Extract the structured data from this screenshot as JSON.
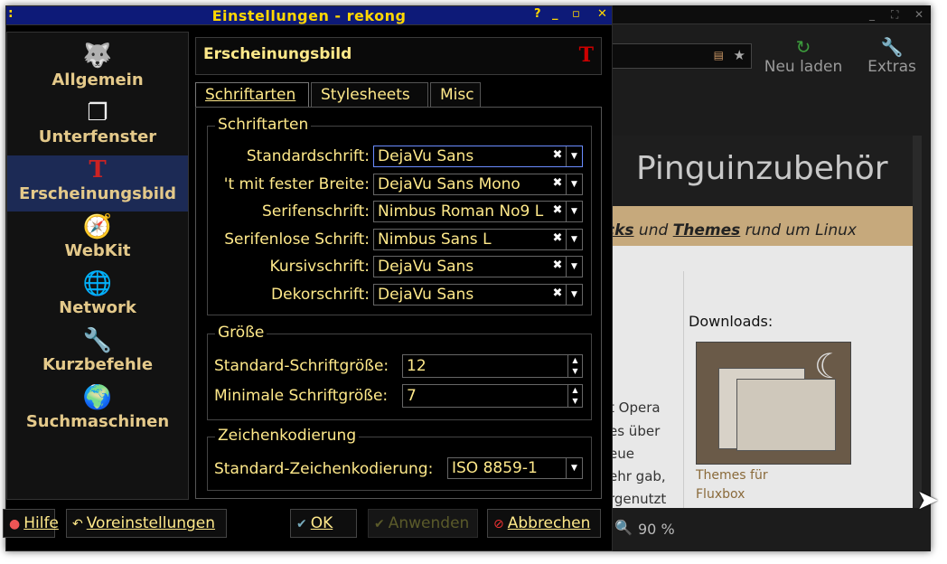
{
  "dialog": {
    "title": "Einstellungen - rekong",
    "left_marker": ":",
    "controls": [
      "?",
      "_",
      "▫",
      "✕"
    ]
  },
  "sidebar": {
    "items": [
      {
        "label": "Allgemein",
        "icon": "wolf-icon"
      },
      {
        "label": "Unterfenster",
        "icon": "windows-icon"
      },
      {
        "label": "Erscheinungsbild",
        "icon": "appearance-icon",
        "active": true
      },
      {
        "label": "WebKit",
        "icon": "compass-icon"
      },
      {
        "label": "Network",
        "icon": "network-globe-icon"
      },
      {
        "label": "Kurzbefehle",
        "icon": "wrench-icon"
      },
      {
        "label": "Suchmaschinen",
        "icon": "search-globe-icon"
      }
    ]
  },
  "page": {
    "title": "Erscheinungsbild",
    "tabs": [
      {
        "label": "Schriftarten",
        "active": true
      },
      {
        "label": "Stylesheets"
      },
      {
        "label": "Misc"
      }
    ]
  },
  "fonts_group": {
    "title": "Schriftarten",
    "rows": [
      {
        "label": "Standardschrift:",
        "value": "DejaVu Sans"
      },
      {
        "label": "'t mit fester Breite:",
        "value": "DejaVu Sans Mono"
      },
      {
        "label": "Serifenschrift:",
        "value": "Nimbus Roman No9 L"
      },
      {
        "label": "Serifenlose Schrift:",
        "value": "Nimbus Sans L"
      },
      {
        "label": "Kursivschrift:",
        "value": "DejaVu Sans"
      },
      {
        "label": "Dekorschrift:",
        "value": "DejaVu Sans"
      }
    ]
  },
  "size_group": {
    "title": "Größe",
    "rows": [
      {
        "label": "Standard-Schriftgröße:",
        "value": "12"
      },
      {
        "label": "Minimale Schriftgröße:",
        "value": "7"
      }
    ]
  },
  "encoding_group": {
    "title": "Zeichenkodierung",
    "label": "Standard-Zeichenkodierung:",
    "value": "ISO 8859-1"
  },
  "buttons": {
    "help": "Hilfe",
    "defaults": "Voreinstellungen",
    "ok": "OK",
    "apply": "Anwenden",
    "cancel": "Abbrechen"
  },
  "browser": {
    "reload": "Neu laden",
    "extras": "Extras",
    "page_title": "Pinguinzubehör",
    "tagline_a": "cks",
    "tagline_b": " und ",
    "tagline_c": "Themes",
    "tagline_d": " rund um Linux",
    "downloads": "Downloads:",
    "caption_1": "Themes für",
    "caption_2": "Fluxbox",
    "text_lines": [
      "t Opera",
      "es über",
      "eue",
      "ehr gab,",
      "rgenutzt"
    ],
    "zoom": "90 %"
  },
  "colors": {
    "titlebar": "#0d1a78",
    "accent": "#ffe98a",
    "active_item": "#1c2a55"
  }
}
